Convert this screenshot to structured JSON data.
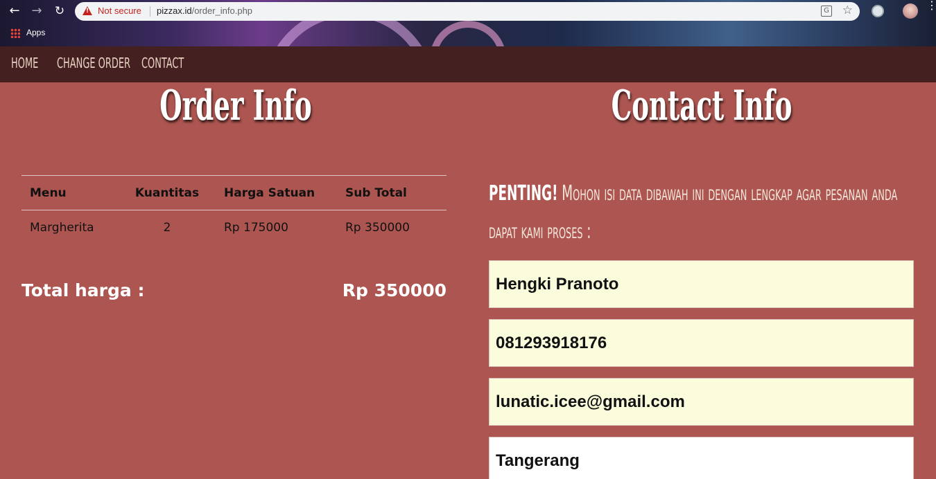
{
  "browser": {
    "security_label": "Not secure",
    "url_domain": "pizzax.id",
    "url_path": "/order_info.php",
    "bookmarks_apps_label": "Apps"
  },
  "nav": {
    "home": "HOME",
    "change_order": "CHANGE ORDER",
    "contact": "CONTACT"
  },
  "order": {
    "title": "Order Info",
    "columns": [
      "Menu",
      "Kuantitas",
      "Harga Satuan",
      "Sub Total"
    ],
    "rows": [
      {
        "menu": "Margherita",
        "qty": "2",
        "unit_price": "Rp 175000",
        "subtotal": "Rp 350000"
      }
    ],
    "total_label": "Total harga :",
    "total_value": "Rp 350000"
  },
  "contact": {
    "title": "Contact Info",
    "notice_strong": "PENTING!",
    "notice_text": " Mohon isi data dibawah ini dengan lengkap agar pesanan anda dapat kami proses :",
    "name": "Hengki Pranoto",
    "phone": "081293918176",
    "email": "lunatic.icee@gmail.com",
    "city": "Tangerang"
  }
}
